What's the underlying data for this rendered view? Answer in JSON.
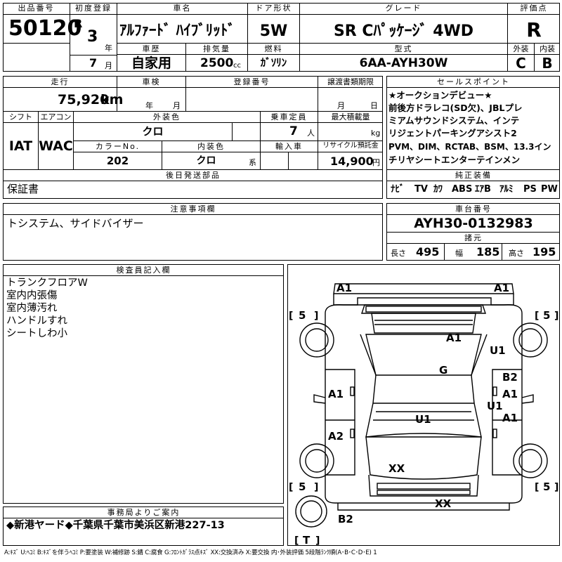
{
  "header": {
    "lot_no_label": "出品番号",
    "lot_no": "50120",
    "first_reg_label": "初度登録",
    "era": "R",
    "year": "3",
    "year_unit": "年",
    "month": "7",
    "month_unit": "月",
    "car_name_label": "車名",
    "car_name": "ｱﾙﾌｧｰﾄﾞ ﾊｲﾌﾞﾘｯﾄﾞ",
    "door_label": "ドア形状",
    "door": "5W",
    "grade_label": "グレード",
    "grade": "SR Cﾊﾟｯｹｰｼﾞ 4WD",
    "score_label": "評価点",
    "score": "R",
    "history_label": "車歴",
    "history": "自家用",
    "displacement_label": "排気量",
    "displacement": "2500",
    "displacement_unit": "cc",
    "fuel_label": "燃料",
    "fuel": "ｶﾞｿﾘﾝ",
    "model_label": "型式",
    "model": "6AA-AYH30W",
    "ext_label": "外装",
    "ext": "C",
    "int_label": "内装",
    "int": "B"
  },
  "details": {
    "mileage_label": "走行",
    "mileage": "75,920",
    "mileage_unit": "km",
    "inspection_label": "車検",
    "insp_year_unit": "年",
    "insp_month_unit": "月",
    "reg_no_label": "登録番号",
    "transfer_label": "譲渡書類期限",
    "transfer_month_unit": "月",
    "transfer_day_unit": "日",
    "shift_label": "シフト",
    "shift": "IAT",
    "ac_label": "エアコン",
    "ac": "WAC",
    "color_label": "外装色",
    "color": "クロ",
    "capacity_label": "乗車定員",
    "capacity": "7",
    "capacity_unit": "人",
    "load_label": "最大積載量",
    "load_unit": "kg",
    "color_no_label": "カラーNo.",
    "color_no": "202",
    "int_color_label": "内装色",
    "int_color": "クロ",
    "int_color_unit": "系",
    "import_label": "輸入車",
    "recycle_label": "リサイクル預託金",
    "recycle": "14,900",
    "recycle_unit": "円",
    "later_label": "後日発送部品",
    "later": "保証書",
    "notes_label": "注意事項欄",
    "notes": "トシステム、サイドバイザー"
  },
  "sales": {
    "label": "セールスポイント",
    "lines": [
      "★オークションデビュー★",
      "前後方ドラレコ(SD欠)、JBLプレ",
      "ミアムサウンドシステム、インテ",
      "リジェントパーキングアシスト2",
      "PVM、DIM、RCTAB、BSM、13.3イン",
      "チリヤシートエンターテインメン"
    ]
  },
  "equipment": {
    "label": "純正装備",
    "items": [
      "ﾅﾋﾞ",
      "TV",
      "ｶﾜ",
      "ABS",
      "ｴｱB",
      "ｱﾙﾐ",
      "PS",
      "PW"
    ]
  },
  "chassis": {
    "label": "車台番号",
    "value": "AYH30-0132983",
    "dims_label": "諸元",
    "len_label": "長さ",
    "len": "495",
    "wid_label": "幅",
    "wid": "185",
    "hgt_label": "高さ",
    "hgt": "195"
  },
  "inspector": {
    "label": "検査員記入欄",
    "lines": [
      "トランクフロアW",
      "室内内張傷",
      "室内薄汚れ",
      "ハンドルすれ",
      "シートしわ小"
    ]
  },
  "diagram": {
    "marks": {
      "a1_tl": "A1",
      "a1_tr": "A1",
      "a1_roof": "A1",
      "u1_right_top": "U1",
      "g": "G",
      "b2_right": "B2",
      "a1_left": "A1",
      "a1_right": "A1",
      "u1_right_mid": "U1",
      "u1_center": "U1",
      "a1_right_low": "A1",
      "a2_left": "A2",
      "xx_hood": "XX",
      "xx_front": "XX",
      "b2_bottom": "B2"
    },
    "tires": {
      "fl": "5",
      "fr": "5",
      "rl": "5",
      "rr": "5",
      "spare": "T"
    }
  },
  "office": {
    "label": "事務局よりご案内",
    "text": "◆新港ヤード◆千葉県千葉市美浜区新港227-13"
  },
  "legend": "A:ｷｽﾞ U:ﾍｺﾐ B:ｷｽﾞを伴うﾍｺﾐ P:要塗装 W:補修跡 S:錆 C:腐食 G:ﾌﾛﾝﾄｶﾞﾗｽ点ｷｽﾞ XX:交換済み X:要交換 内･外装評価 5段階ﾗﾝｸ順(A･B･C･D･E) 1"
}
